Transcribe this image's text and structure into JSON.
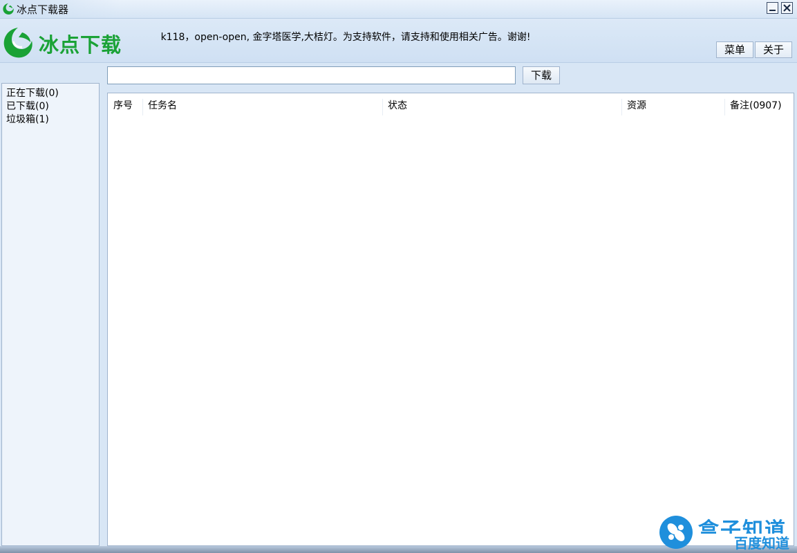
{
  "window": {
    "title": "冰点下载器"
  },
  "header": {
    "brand": "冰点下载",
    "marquee": "ok118，open-open, 金字塔医学,大桔灯。为支持软件，请支持和使用相关广告。谢谢!",
    "menu_label": "菜单",
    "about_label": "关于"
  },
  "toolbar": {
    "url_value": "",
    "url_placeholder": "",
    "download_label": "下载"
  },
  "sidebar": {
    "items": [
      {
        "label": "正在下载(0)"
      },
      {
        "label": "已下载(0)"
      },
      {
        "label": "垃圾箱(1)"
      }
    ]
  },
  "table": {
    "columns": [
      "序号",
      "任务名",
      "状态",
      "资源",
      "备注(0907)"
    ],
    "rows": []
  },
  "watermark": {
    "line1": "盒子知道",
    "line2": "百度知道"
  },
  "colors": {
    "brand_green": "#1aa236",
    "window_blue": "#d8e6f5",
    "watermark_blue": "#1f8fdc"
  }
}
